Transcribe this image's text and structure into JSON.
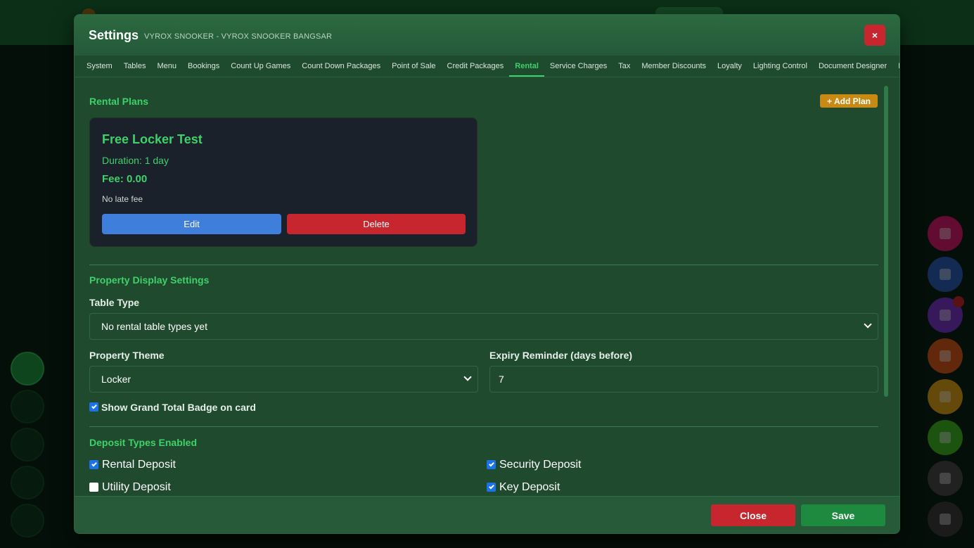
{
  "modal": {
    "title": "Settings",
    "subtitle": "VYROX SNOOKER - VYROX SNOOKER BANGSAR",
    "close_icon": "×"
  },
  "tabs": [
    {
      "label": "System"
    },
    {
      "label": "Tables"
    },
    {
      "label": "Menu"
    },
    {
      "label": "Bookings"
    },
    {
      "label": "Count Up Games"
    },
    {
      "label": "Count Down Packages"
    },
    {
      "label": "Point of Sale"
    },
    {
      "label": "Credit Packages"
    },
    {
      "label": "Rental",
      "active": true
    },
    {
      "label": "Service Charges"
    },
    {
      "label": "Tax"
    },
    {
      "label": "Member Discounts"
    },
    {
      "label": "Loyalty"
    },
    {
      "label": "Lighting Control"
    },
    {
      "label": "Document Designer"
    },
    {
      "label": "Printers"
    }
  ],
  "rental_plans": {
    "section_title": "Rental Plans",
    "add_button": "+ Add Plan",
    "plans": [
      {
        "name": "Free Locker Test",
        "duration": "Duration: 1 day",
        "fee": "Fee: 0.00",
        "late_fee": "No late fee",
        "edit_label": "Edit",
        "delete_label": "Delete"
      }
    ]
  },
  "property_display": {
    "section_title": "Property Display Settings",
    "table_type_label": "Table Type",
    "table_type_value": "No rental table types yet",
    "theme_label": "Property Theme",
    "theme_value": "Locker",
    "expiry_label": "Expiry Reminder (days before)",
    "expiry_value": "7",
    "show_badge_label": "Show Grand Total Badge on card",
    "show_badge_checked": true
  },
  "deposit_types": {
    "section_title": "Deposit Types Enabled",
    "items": [
      {
        "label": "Rental Deposit",
        "checked": true
      },
      {
        "label": "Security Deposit",
        "checked": true
      },
      {
        "label": "Utility Deposit",
        "checked": false
      },
      {
        "label": "Key Deposit",
        "checked": true
      }
    ]
  },
  "footer": {
    "close_label": "Close",
    "save_label": "Save"
  },
  "colors": {
    "accent_green": "#3fd16a",
    "danger": "#c8262e",
    "primary": "#3f7fdb",
    "warning": "#c98a13",
    "save": "#1e8a3f"
  }
}
